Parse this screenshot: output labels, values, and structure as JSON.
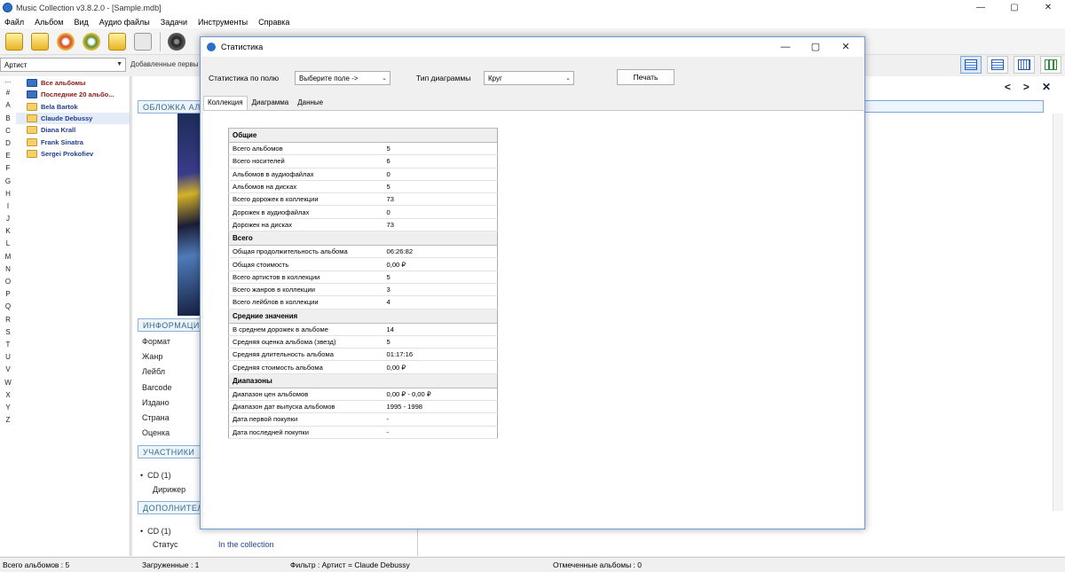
{
  "window": {
    "title": "Music Collection v3.8.2.0 - [Sample.mdb]",
    "controls": [
      "—",
      "▢",
      "✕"
    ]
  },
  "menu": [
    "Файл",
    "Альбом",
    "Вид",
    "Аудио файлы",
    "Задачи",
    "Инструменты",
    "Справка"
  ],
  "filter": {
    "field": "Артист",
    "sort": "Добавленные первы"
  },
  "alphabet": [
    "...",
    "#",
    "A",
    "B",
    "C",
    "D",
    "E",
    "F",
    "G",
    "H",
    "I",
    "J",
    "K",
    "L",
    "M",
    "N",
    "O",
    "P",
    "Q",
    "R",
    "S",
    "T",
    "U",
    "V",
    "W",
    "X",
    "Y",
    "Z"
  ],
  "tree": [
    {
      "label": "Все альбомы",
      "kind": "album",
      "style": "red"
    },
    {
      "label": "Последние 20 альбо...",
      "kind": "album",
      "style": "red"
    },
    {
      "label": "Bela Bartok",
      "kind": "folder",
      "style": "blue"
    },
    {
      "label": "Claude Debussy",
      "kind": "folder",
      "style": "blue"
    },
    {
      "label": "Diana Krall",
      "kind": "folder",
      "style": "blue"
    },
    {
      "label": "Frank Sinatra",
      "kind": "folder",
      "style": "blue"
    },
    {
      "label": "Sergei Prokofiev",
      "kind": "folder",
      "style": "blue"
    }
  ],
  "nav": {
    "prev": "<",
    "next": ">",
    "close": "✕"
  },
  "album_panel": {
    "cover_header": "ОБЛОЖКА АЛЬ",
    "info_header": "ИНФОРМАЦИ",
    "info_labels": [
      "Формат",
      "Жанр",
      "Лейбл",
      "Barcode",
      "Издано",
      "Страна",
      "Оценка"
    ],
    "participants_header": "УЧАСТНИКИ",
    "participants_cd": "CD (1)",
    "participants_role": "Дирижер",
    "additional_header": "ДОПОЛНИТЕЛ",
    "additional_cd": "CD (1)",
    "status_label": "Статус",
    "status_value": "In the collection"
  },
  "statusbar": {
    "total": "Всего альбомов : 5",
    "loaded": "Загруженные : 1",
    "filter": "Фильтр : Артист = Claude Debussy",
    "marked": "Отмеченные альбомы : 0"
  },
  "modal": {
    "title": "Статистика",
    "field_label": "Статистика по полю",
    "field_value": "Выберите поле ->",
    "chart_label": "Тип диаграммы",
    "chart_value": "Круг",
    "print": "Печать",
    "tabs": [
      "Коллекция",
      "Диаграмма",
      "Данные"
    ],
    "sections": [
      {
        "title": "Общие",
        "rows": [
          [
            "Всего альбомов",
            "5"
          ],
          [
            "Всего носителей",
            "6"
          ],
          [
            "Альбомов в аудиофайлах",
            "0"
          ],
          [
            "Альбомов на дисках",
            "5"
          ],
          [
            "Всего дорожек в коллекции",
            "73"
          ],
          [
            "Дорожек в аудиофайлах",
            "0"
          ],
          [
            "Дорожек на дисках",
            "73"
          ]
        ]
      },
      {
        "title": "Всего",
        "rows": [
          [
            "Общая продолжительность альбома",
            "06:26:82"
          ],
          [
            "Общая стоимость",
            "0,00 ₽"
          ],
          [
            "Всего артистов в коллекции",
            "5"
          ],
          [
            "Всего жанров в коллекции",
            "3"
          ],
          [
            "Всего лейблов в коллекции",
            "4"
          ]
        ]
      },
      {
        "title": "Средние значения",
        "rows": [
          [
            "В среднем дорожек в альбоме",
            "14"
          ],
          [
            "Средняя оценка альбома (звезд)",
            "5"
          ],
          [
            "Средняя длительность альбома",
            "01:17:16"
          ],
          [
            "Средняя стоимость альбома",
            "0,00 ₽"
          ]
        ]
      },
      {
        "title": "Диапазоны",
        "rows": [
          [
            "Диапазон цен альбомов",
            "0,00 ₽  -  0,00 ₽"
          ],
          [
            "Диапазон дат выпуска альбомов",
            "1995  -  1998"
          ],
          [
            "Дата первой покупки",
            "-"
          ],
          [
            "Дата последней покупки",
            "-"
          ]
        ]
      }
    ]
  }
}
